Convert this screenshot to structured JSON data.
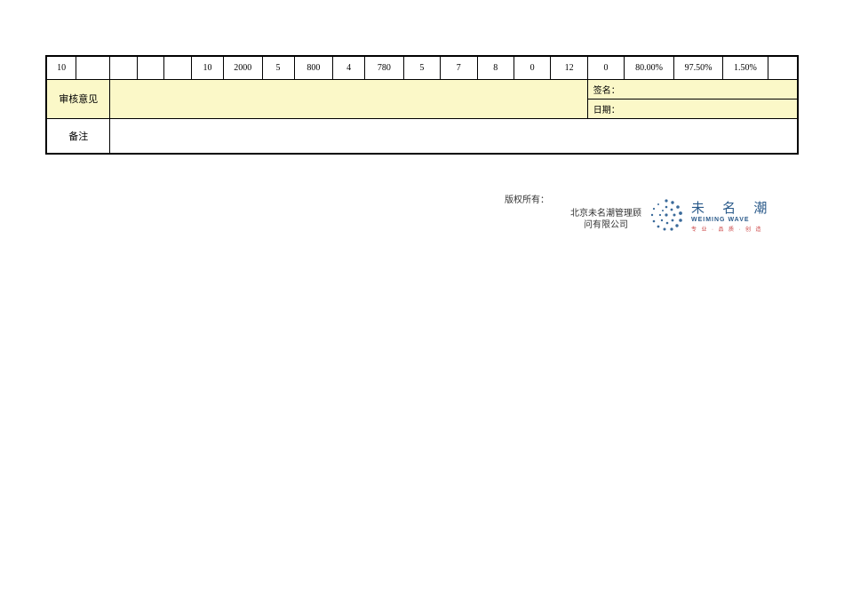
{
  "dataRow": {
    "cells": [
      "10",
      "",
      "",
      "",
      "",
      "10",
      "2000",
      "5",
      "800",
      "4",
      "780",
      "5",
      "7",
      "8",
      "0",
      "12",
      "0",
      "80.00%",
      "97.50%",
      "1.50%",
      ""
    ]
  },
  "reviewLabel": "审核意见",
  "signLabel": "签名：",
  "dateLabel": "日期：",
  "notesLabel": "备注",
  "footer": {
    "copyright": "版权所有：",
    "company": "北京未名潮管理顾问有限公司"
  },
  "logo": {
    "cn": "未 名 潮",
    "en": "WEIMING WAVE",
    "sub": "专 业 · 品 质 · 创 造"
  }
}
